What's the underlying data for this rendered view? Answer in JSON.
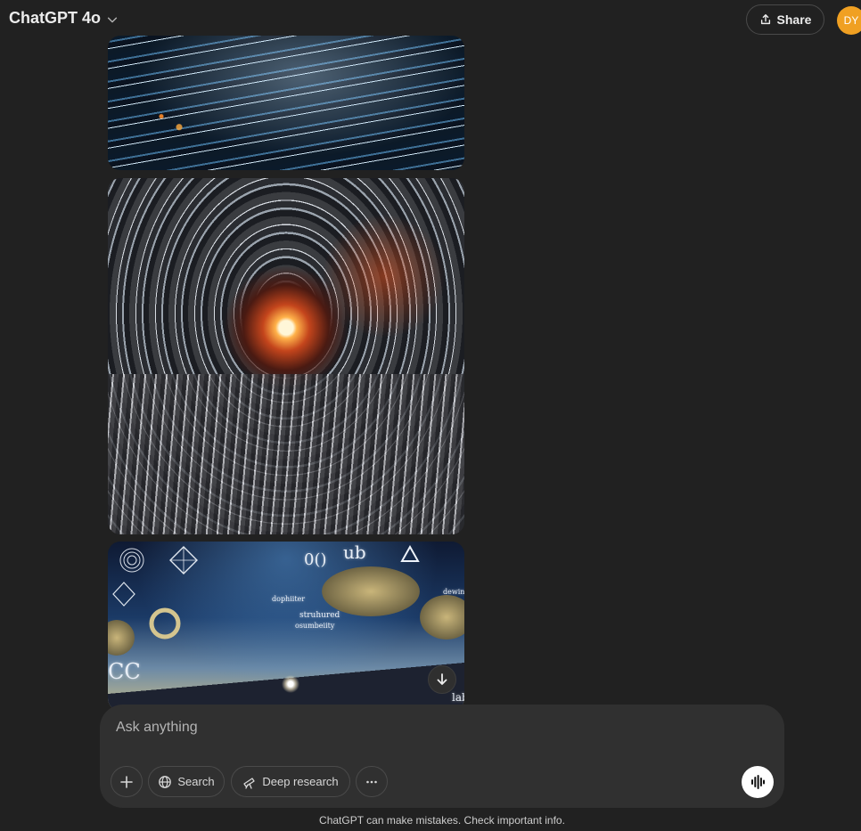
{
  "header": {
    "model_name": "ChatGPT 4o",
    "share_label": "Share",
    "avatar_initials": "DY"
  },
  "images": {
    "image3_text": {
      "ub": "ub",
      "circles": "0()",
      "cc": "CC",
      "line1": "dophiiter",
      "line2": "struhured",
      "line3": "osumbeiity",
      "dewin": "dewin",
      "lab": "lab"
    }
  },
  "composer": {
    "placeholder": "Ask anything",
    "search_label": "Search",
    "deep_research_label": "Deep research"
  },
  "footer": {
    "disclaimer": "ChatGPT can make mistakes. Check important info."
  },
  "colors": {
    "background": "#212121",
    "composer": "#303030",
    "avatar": "#f0a022",
    "text": "#ececec"
  }
}
